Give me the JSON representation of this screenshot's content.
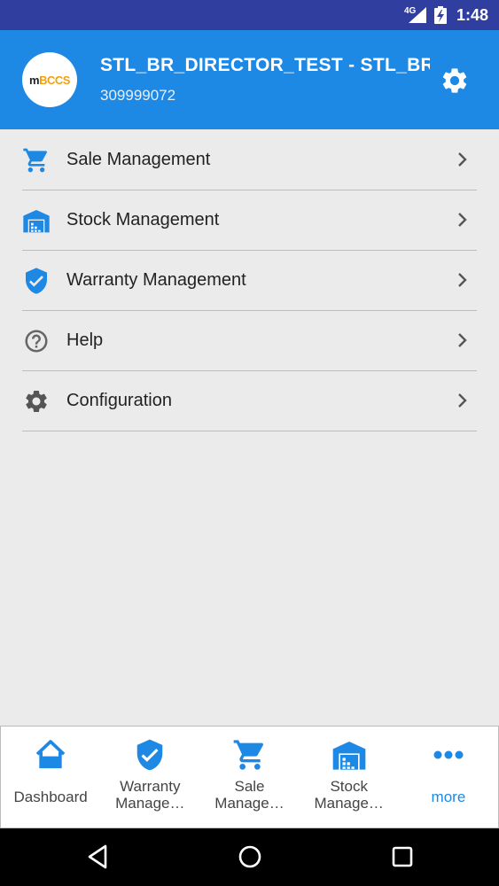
{
  "status_bar": {
    "network": "4G",
    "time": "1:48"
  },
  "header": {
    "logo_text_m": "m",
    "logo_text_rest": "BCCS",
    "title": "STL_BR_DIRECTOR_TEST - STL_BR",
    "subtitle": "309999072"
  },
  "menu": [
    {
      "label": "Sale Management",
      "icon": "cart-icon"
    },
    {
      "label": "Stock Management",
      "icon": "warehouse-icon"
    },
    {
      "label": "Warranty Management",
      "icon": "shield-check-icon"
    },
    {
      "label": "Help",
      "icon": "help-circle-icon"
    },
    {
      "label": "Configuration",
      "icon": "gear-icon"
    }
  ],
  "bottom_nav": [
    {
      "label": "Dashboard",
      "icon": "home-icon"
    },
    {
      "line1": "Warranty",
      "line2": "Manage…",
      "icon": "shield-check-icon"
    },
    {
      "line1": "Sale",
      "line2": "Manage…",
      "icon": "cart-icon"
    },
    {
      "line1": "Stock",
      "line2": "Manage…",
      "icon": "warehouse-icon"
    },
    {
      "label": "more",
      "icon": "more-dots-icon"
    }
  ],
  "colors": {
    "primary": "#1e88e5",
    "status_bar": "#303f9f",
    "background": "#ebebeb",
    "logo_accent": "#f59e0b"
  }
}
